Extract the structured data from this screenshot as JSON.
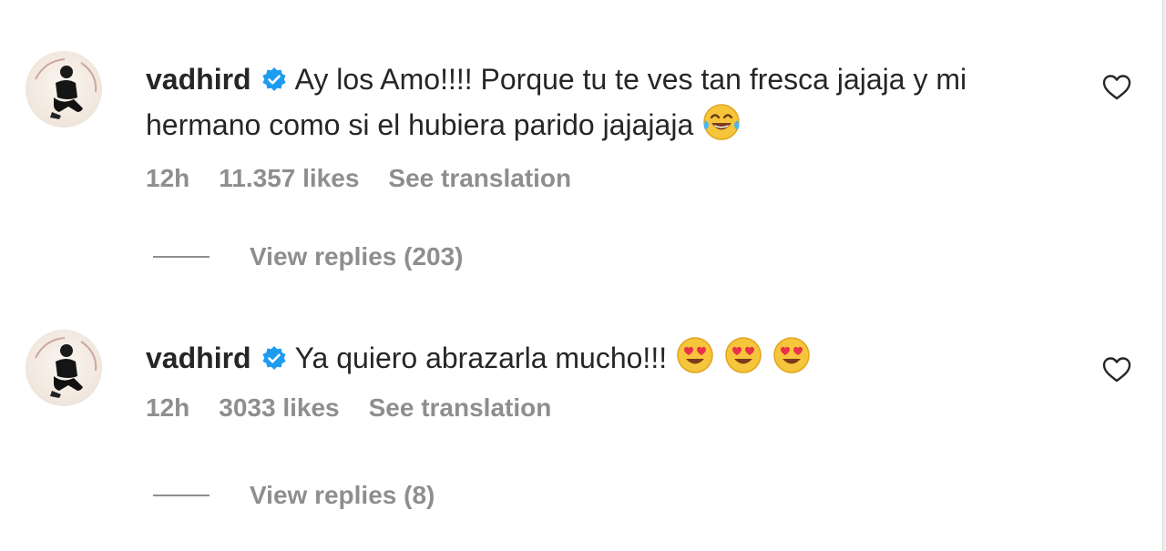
{
  "comments": [
    {
      "username": "vadhird",
      "text": "Ay los Amo!!!! Porque tu te ves tan fresca jajaja y mi hermano como si el hubiera parido jajajaja",
      "emoji": [
        "face-with-tears-of-joy"
      ],
      "time": "12h",
      "likes": "11.357 likes",
      "translate": "See translation",
      "replies": "View replies (203)"
    },
    {
      "username": "vadhird",
      "text": "Ya quiero abrazarla mucho!!!",
      "emoji": [
        "smiling-face-with-heart-eyes",
        "smiling-face-with-heart-eyes",
        "smiling-face-with-heart-eyes"
      ],
      "time": "12h",
      "likes": "3033 likes",
      "translate": "See translation",
      "replies": "View replies (8)"
    }
  ],
  "icons": {
    "verified": "verified-badge-icon",
    "like": "heart-outline-icon"
  },
  "colors": {
    "text": "#262626",
    "secondary": "#8e8e8e",
    "verified": "#1d9bf0"
  }
}
